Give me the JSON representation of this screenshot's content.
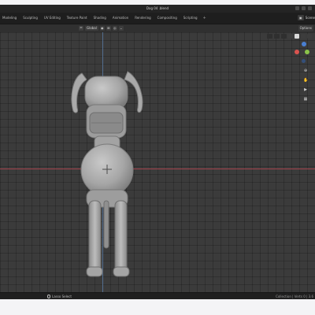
{
  "window": {
    "title": "Dog 04 .blend"
  },
  "tabs": [
    {
      "label": "Modeling",
      "active": false
    },
    {
      "label": "Sculpting",
      "active": false
    },
    {
      "label": "UV Editing",
      "active": false
    },
    {
      "label": "Texture Paint",
      "active": false
    },
    {
      "label": "Shading",
      "active": false
    },
    {
      "label": "Animation",
      "active": false
    },
    {
      "label": "Rendering",
      "active": false
    },
    {
      "label": "Compositing",
      "active": false
    },
    {
      "label": "Scripting",
      "active": false
    }
  ],
  "tab_add": "+",
  "scene": {
    "label": "Scene"
  },
  "header": {
    "transform_orientation": "Global",
    "options_label": "Options"
  },
  "status": {
    "left_text": "Lasso Select",
    "right_text": "Collection | Verts 0 | 3.6"
  },
  "colors": {
    "axis_x": "#a4454f",
    "axis_y": "#5d7ea8",
    "gizmo_x": "#d9534f",
    "gizmo_y": "#8bc34a",
    "gizmo_z": "#4a7fd1"
  },
  "icons": [
    "mouse-icon",
    "view-gizmo",
    "zoom-icon",
    "hand-icon",
    "camera-icon",
    "grid-icon"
  ]
}
